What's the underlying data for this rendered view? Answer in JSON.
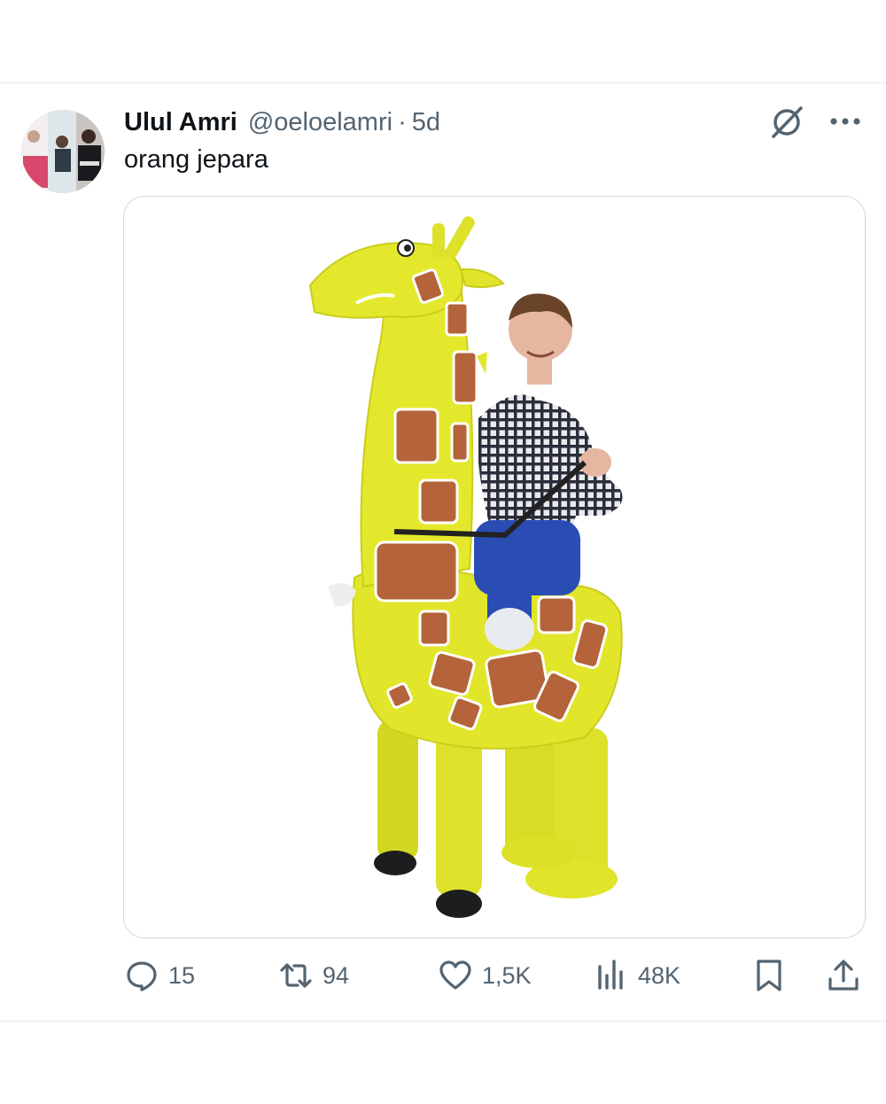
{
  "tweet": {
    "display_name": "Ulul Amri",
    "handle": "@oeloelamri",
    "separator": "·",
    "time": "5d",
    "text": "orang jepara",
    "image_description_icon": "inflatable-giraffe-costume-photo"
  },
  "actions": {
    "reply": {
      "icon": "reply-icon",
      "count": "15"
    },
    "retweet": {
      "icon": "retweet-icon",
      "count": "94"
    },
    "like": {
      "icon": "like-icon",
      "count": "1,5K"
    },
    "views": {
      "icon": "views-icon",
      "count": "48K"
    },
    "bookmark": {
      "icon": "bookmark-icon"
    },
    "share": {
      "icon": "share-icon"
    }
  },
  "colors": {
    "text_primary": "#0f1419",
    "text_secondary": "#536471",
    "border": "#cfd9de",
    "giraffe_yellow": "#e2e62a",
    "giraffe_spot": "#b4633a"
  }
}
